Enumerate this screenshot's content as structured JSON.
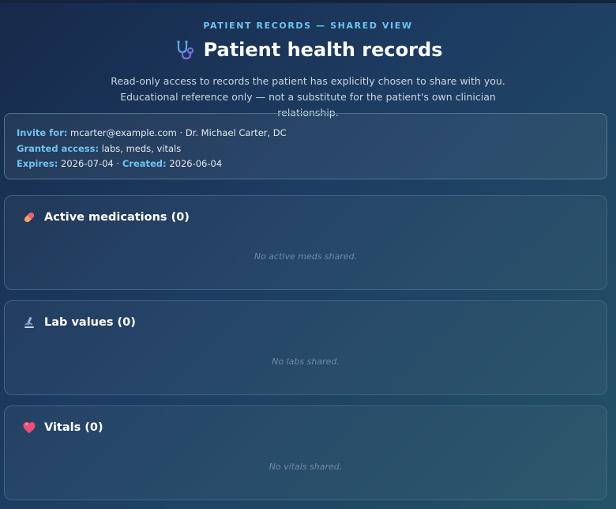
{
  "header": {
    "eyebrow": "PATIENT RECORDS — SHARED VIEW",
    "title": "Patient health records",
    "subtitle": "Read-only access to records the patient has explicitly chosen to share with you. Educational reference only — not a substitute for the patient's own clinician relationship.",
    "icon": "stethoscope-icon"
  },
  "invite": {
    "invite_label": "Invite for:",
    "invite_value": "mcarter@example.com · Dr. Michael Carter, DC",
    "access_label": "Granted access:",
    "access_value": "labs, meds, vitals",
    "expires_label": "Expires:",
    "expires_value": "2026-07-04",
    "separator": " · ",
    "created_label": "Created:",
    "created_value": "2026-06-04"
  },
  "sections": {
    "meds": {
      "title": "Active medications (0)",
      "empty": "No active meds shared.",
      "icon": "pill-icon"
    },
    "labs": {
      "title": "Lab values (0)",
      "empty": "No labs shared.",
      "icon": "microscope-icon"
    },
    "vitals": {
      "title": "Vitals (0)",
      "empty": "No vitals shared.",
      "icon": "heart-icon"
    }
  },
  "colors": {
    "accent": "#6fc3f0",
    "background_start": "#16294a",
    "background_end": "#235266",
    "card_border": "#3f6484",
    "empty_text": "#6f8aa3"
  }
}
